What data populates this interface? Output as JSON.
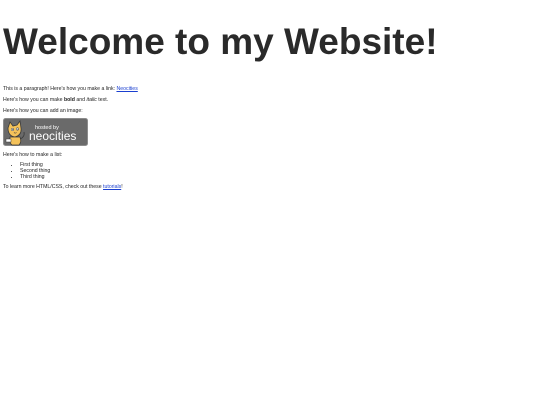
{
  "heading": "Welcome to my Website!",
  "paragraph1": {
    "text_before": "This is a paragraph! Here's how you make a link: ",
    "link_label": "Neocities"
  },
  "paragraph2": {
    "text_before": "Here's how you can make ",
    "bold_text": "bold",
    "text_middle": " and ",
    "italic_text": "italic",
    "text_after": " text."
  },
  "paragraph3": {
    "text": "Here's how you can add an image:"
  },
  "badge": {
    "small_text": "hosted by",
    "brand_text": "neocities",
    "icon": "neocities-cat-icon",
    "colors": {
      "background": "#6a6a6a",
      "border": "#8c8c8c",
      "text": "#ffffff",
      "cat": "#f4c25a"
    }
  },
  "paragraph4": {
    "text": "Here's how to make a list:"
  },
  "list": {
    "items": [
      "First thing",
      "Second thing",
      "Third thing"
    ]
  },
  "paragraph5": {
    "text_before": "To learn more HTML/CSS, check out these ",
    "link_label": "tutorials",
    "text_after": "!"
  },
  "colors": {
    "link": "#1a3fd0",
    "text": "#222222",
    "heading": "#2a2a2a",
    "background": "#ffffff"
  }
}
